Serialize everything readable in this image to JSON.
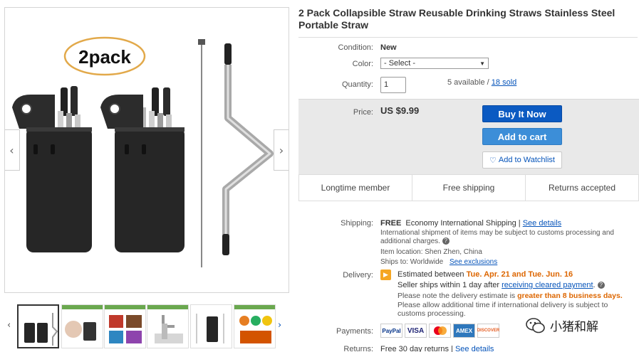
{
  "product": {
    "title": "2 Pack Collapsible Straw Reusable Drinking Straws Stainless Steel Portable Straw"
  },
  "gallery": {
    "badge": "2pack",
    "prev_arrow": "‹",
    "next_arrow": "›",
    "thumb_prev": "‹",
    "thumb_next": "›"
  },
  "details": {
    "condition_label": "Condition:",
    "condition_value": "New",
    "color_label": "Color:",
    "color_select": "- Select -",
    "quantity_label": "Quantity:",
    "quantity_value": "1",
    "available_text": "5 available /",
    "sold_link": "18 sold"
  },
  "price": {
    "label": "Price:",
    "value": "US $9.99",
    "buy_now": "Buy It Now",
    "add_to_cart": "Add to cart",
    "watchlist": "Add to Watchlist"
  },
  "features": [
    "Longtime member",
    "Free shipping",
    "Returns accepted"
  ],
  "shipping": {
    "label": "Shipping:",
    "free": "FREE",
    "service": "Economy International Shipping |",
    "see_details": "See details",
    "note": "International shipment of items may be subject to customs processing and additional charges.",
    "location_label": "Item location:",
    "location": "Shen Zhen, China",
    "ships_to_label": "Ships to:",
    "ships_to": "Worldwide",
    "exclusions": "See exclusions"
  },
  "delivery": {
    "label": "Delivery:",
    "estimated_prefix": "Estimated between",
    "date_range": "Tue. Apr. 21 and Tue. Jun. 16",
    "ships_within": "Seller ships within 1 day after",
    "cleared_link": "receiving cleared payment",
    "note_prefix": "Please note the delivery estimate is",
    "note_highlight": "greater than 8 business days.",
    "note_extra": "Please allow additional time if international delivery is subject to customs processing."
  },
  "payments": {
    "label": "Payments:",
    "methods": [
      "PayPal",
      "VISA",
      "MasterCard",
      "AMEX",
      "DISCOVER"
    ]
  },
  "returns": {
    "label": "Returns:",
    "value": "Free 30 day returns |",
    "see_details": "See details"
  },
  "watermark": {
    "text": "小猪和解"
  },
  "colors": {
    "buy_now": "#0b5ac2",
    "add_to_cart": "#3c8ed8",
    "link": "#0654ba",
    "highlight": "#dd6600"
  }
}
